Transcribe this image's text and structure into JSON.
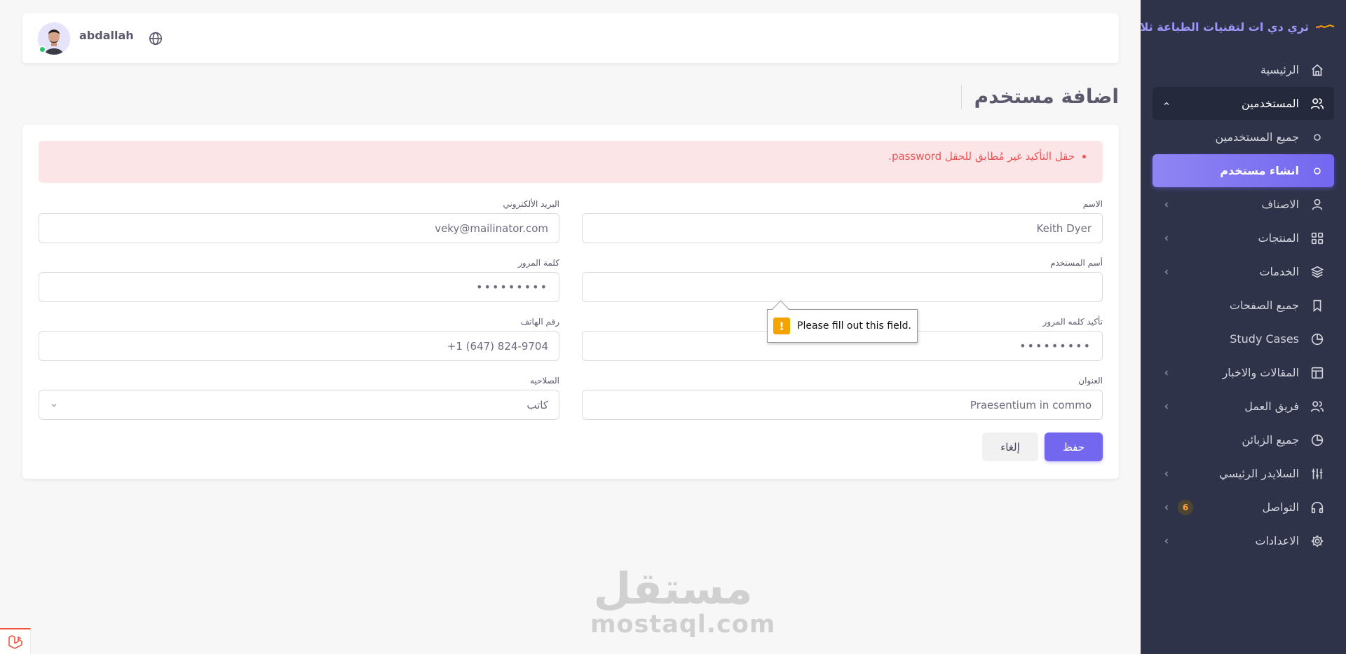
{
  "brand": {
    "name": "ثري دي ات لتقنيات الطباعة ثلاثية الأبعاد"
  },
  "sidebar": {
    "items": [
      {
        "label": "الرئيسية",
        "icon": "home-icon"
      },
      {
        "label": "المستخدمين",
        "icon": "users-icon",
        "open": true
      },
      {
        "label": "جميع المستخدمين",
        "icon": "circle-icon",
        "sub": true
      },
      {
        "label": "انشاء مستخدم",
        "icon": "circle-icon",
        "sub": true,
        "active": true
      },
      {
        "label": "الاصناف",
        "icon": "user-icon"
      },
      {
        "label": "المنتجات",
        "icon": "grid-icon"
      },
      {
        "label": "الخدمات",
        "icon": "layers-icon"
      },
      {
        "label": "جميع الصفحات",
        "icon": "bookmark-icon"
      },
      {
        "label": "Study Cases",
        "icon": "pie-icon"
      },
      {
        "label": "المقالات والاخبار",
        "icon": "layout-icon"
      },
      {
        "label": "فريق العمل",
        "icon": "team-icon"
      },
      {
        "label": "جميع الزبائن",
        "icon": "pie-icon"
      },
      {
        "label": "السلايدر الرئيسي",
        "icon": "sliders-icon"
      },
      {
        "label": "التواصل",
        "icon": "headphones-icon",
        "badge": "6"
      },
      {
        "label": "الاعدادات",
        "icon": "settings-icon"
      }
    ]
  },
  "topbar": {
    "username": "abdallah"
  },
  "page": {
    "title": "اضافة مستخدم"
  },
  "alert": {
    "message": "حقل التأكيد غير مُطابق للحقل password."
  },
  "form": {
    "name": {
      "label": "الاسم",
      "value": "Keith Dyer"
    },
    "email": {
      "label": "البريد الألكتروني",
      "value": "veky@mailinator.com"
    },
    "username": {
      "label": "أسم المستخدم",
      "value": ""
    },
    "password": {
      "label": "كلمة المرور",
      "value": "•••••••••"
    },
    "password_confirm": {
      "label": "تأكيد كلمه المرور",
      "value": "•••••••••"
    },
    "phone": {
      "label": "رقم الهاتف",
      "value": "+1 (647) 824-9704"
    },
    "address": {
      "label": "العنوان",
      "value": "Praesentium in commo"
    },
    "role": {
      "label": "الصلاحيه",
      "value": "كاتب"
    },
    "save_label": "حفظ",
    "cancel_label": "إلغاء"
  },
  "tooltip": {
    "message": "Please fill out this field."
  },
  "watermark": {
    "arabic": "مستقل",
    "latin": "mostaql.com"
  },
  "colors": {
    "primary": "#7367f0",
    "sidebar": "#2f3349",
    "danger": "#ea5455",
    "warning": "#ff9f43"
  }
}
